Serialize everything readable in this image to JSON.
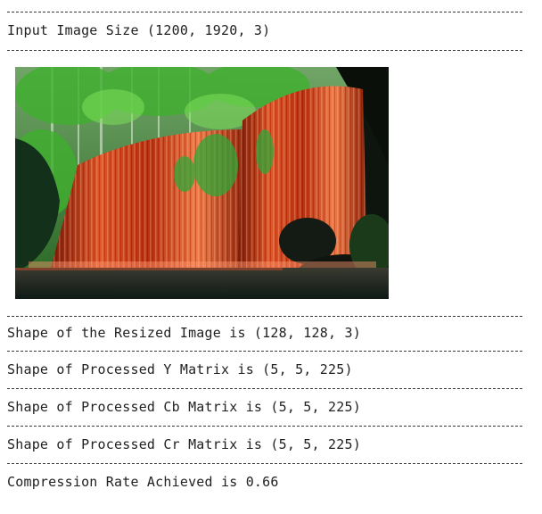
{
  "output": {
    "separator": "------------------------------------------------------------------------",
    "input_size_text": "Input Image Size (1200, 1920, 3)",
    "resized_text": "Shape of the Resized Image is (128, 128, 3)",
    "y_matrix_text": "Shape of Processed Y Matrix is (5, 5, 225)",
    "cb_matrix_text": "Shape of Processed Cb Matrix is (5, 5, 225)",
    "cr_matrix_text": "Shape of Processed Cr Matrix is (5, 5, 225)",
    "compression_text": "Compression Rate Achieved is 0.66"
  },
  "image": {
    "subject": "waterfall-photo",
    "colors": {
      "foliage": "#2f8a2a",
      "foliage_light": "#6fd24a",
      "water": "#d8431f",
      "water_light": "#ff8a55",
      "pool": "#1a2a26",
      "rock": "#141a14"
    }
  }
}
